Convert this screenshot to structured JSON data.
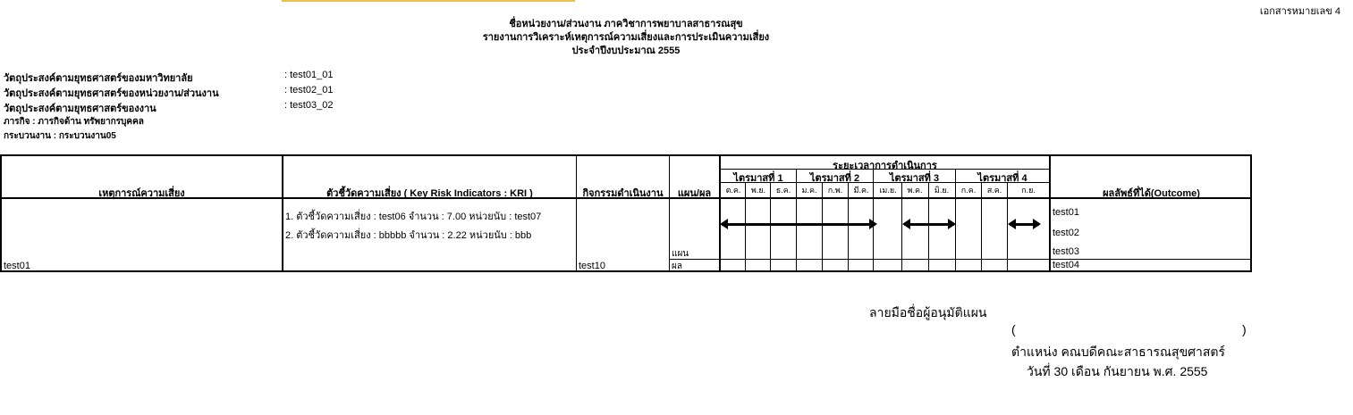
{
  "doc_number": "เอกสารหมายเลข 4",
  "header": {
    "line1": "ชื่อหน่วยงาน/ส่วนงาน ภาควิชาการพยาบาลสาธารณสุข",
    "line2": "รายงานการวิเคราะห์เหตุการณ์ความเสี่ยงและการประเมินความเสี่ยง",
    "line3": "ประจำปีงบประมาณ 2555"
  },
  "info": {
    "uni_label": "วัตถุประสงค์ตามยุทธศาสตร์ของมหาวิทยาลัย",
    "uni_value": ": test01_01",
    "unit_label": "วัตถุประสงค์ตามยุทธศาสตร์ของหน่วยงาน/ส่วนงาน",
    "unit_value": ": test02_01",
    "work_label": "วัตถุประสงค์ตามยุทธศาสตร์ของงาน",
    "work_value": ": test03_02",
    "mission": "ภารกิจ : ภารกิจด้าน ทรัพยากรบุคคล",
    "process": "กระบวนงาน : กระบวนงาน05"
  },
  "table": {
    "headers": {
      "risk_event": "เหตุการณ์ความเสี่ยง",
      "kri": "ตัวชี้วัดความเสี่ยง ( Key Risk Indicators : KRI )",
      "activity": "กิจกรรมดำเนินงาน",
      "plan_result": "แผน/ผล",
      "period": "ระยะเวลาการดำเนินการ",
      "outcome": "ผลลัพธ์ที่ได้(Outcome)"
    },
    "quarters": [
      "ไตรมาสที่ 1",
      "ไตรมาสที่ 2",
      "ไตรมาสที่ 3",
      "ไตรมาสที่ 4"
    ],
    "months": [
      "ต.ค.",
      "พ.ย.",
      "ธ.ค.",
      "ม.ค.",
      "ก.พ.",
      "มี.ค.",
      "เม.ย.",
      "พ.ค.",
      "มิ.ย.",
      "ก.ค.",
      "ส.ค.",
      "ก.ย."
    ],
    "row": {
      "risk_event": "test01",
      "kri": [
        "1. ตัวชี้วัดความเสี่ยง : test06 จำนวน : 7.00 หน่วยนับ : test07",
        "2. ตัวชี้วัดความเสี่ยง : bbbbb จำนวน : 2.22 หน่วยนับ : bbb"
      ],
      "activity": "test10",
      "plan_label": "แผน",
      "result_label": "ผล",
      "outcomes": [
        "test01",
        "test02",
        "test03",
        "test04"
      ],
      "plan_spans": [
        {
          "start_month": "ต.ค.",
          "end_month": "มี.ค."
        },
        {
          "start_month": "พ.ค.",
          "end_month": "มิ.ย."
        },
        {
          "start_month": "ก.ย.",
          "end_month": "ก.ย."
        }
      ]
    }
  },
  "signature": {
    "title": "ลายมือชื่อผู้อนุมัติแผน",
    "open_paren": "(",
    "close_paren": ")",
    "position": "ตำแหน่ง คณบดีคณะสาธารณสุขศาสตร์",
    "date": "วันที่ 30 เดือน กันยายน พ.ศ. 2555"
  }
}
